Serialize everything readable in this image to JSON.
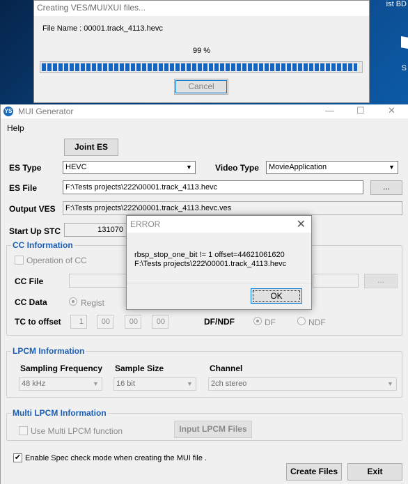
{
  "desktop": {
    "corner_text": "ist BD",
    "corner_text2": "S"
  },
  "progress_window": {
    "title": "Creating VES/MUI/XUI files...",
    "file_name_label": "File Name : 00001.track_4113.hevc",
    "percent_text": "99 %",
    "progress_fraction": 0.99,
    "cancel_label": "Cancel"
  },
  "main_window": {
    "title": "MUI Generator",
    "menu_help": "Help",
    "joint_es_label": "Joint ES",
    "es_type": {
      "label": "ES Type",
      "value": "HEVC"
    },
    "video_type": {
      "label": "Video Type",
      "value": "MovieApplication"
    },
    "es_file": {
      "label": "ES File",
      "value": "F:\\Tests projects\\222\\00001.track_4113.hevc",
      "browse": "..."
    },
    "output_ves": {
      "label": "Output VES",
      "value": "F:\\Tests projects\\222\\00001.track_4113.hevc.ves"
    },
    "start_up_stc": {
      "label": "Start Up STC",
      "value": "131070"
    },
    "cc_info": {
      "title": "CC Information",
      "operation_label": "Operation of CC",
      "cc_file_label": "CC File",
      "cc_file_browse": "...",
      "cc_data_label": "CC Data",
      "regist_label": "Regist",
      "tc_offset_label": "TC to offset",
      "tc_values": [
        "1",
        "00",
        "00",
        "00"
      ],
      "df_ndf_label": "DF/NDF",
      "df_label": "DF",
      "ndf_label": "NDF"
    },
    "lpcm_info": {
      "title": "LPCM Information",
      "sampling_label": "Sampling Frequency",
      "sampling_value": "48 kHz",
      "sample_size_label": "Sample Size",
      "sample_size_value": "16 bit",
      "channel_label": "Channel",
      "channel_value": "2ch stereo"
    },
    "multi_lpcm": {
      "title": "Multi LPCM Information",
      "use_label": "Use Multi LPCM function",
      "input_button": "Input LPCM Files"
    },
    "spec_check_label": "Enable Spec check mode when creating the MUI file .",
    "create_files_label": "Create Files",
    "exit_label": "Exit"
  },
  "error_dialog": {
    "title": "ERROR",
    "message_line1": "rbsp_stop_one_bit != 1 offset=44621061620",
    "message_line2": "F:\\Tests projects\\222\\00001.track_4113.hevc",
    "ok_label": "OK"
  }
}
